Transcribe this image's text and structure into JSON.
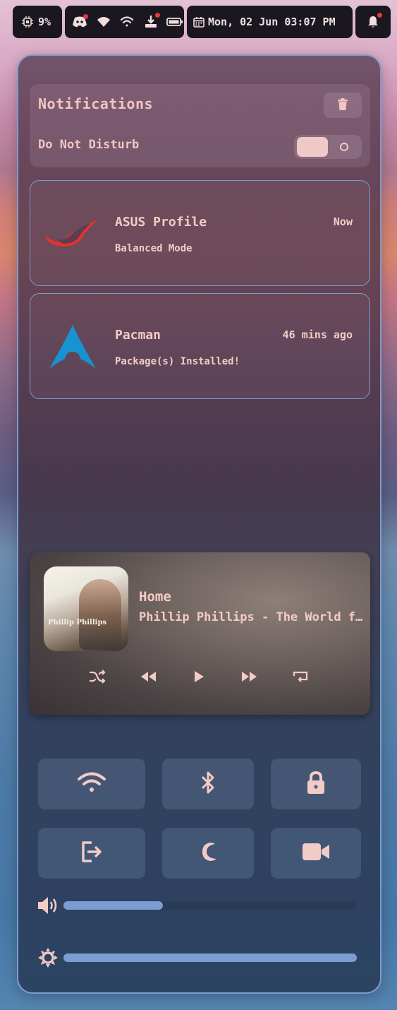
{
  "topbar": {
    "cpu_usage": "9%",
    "clock": "Mon, 02 Jun 03:07 PM"
  },
  "notifications": {
    "title": "Notifications",
    "dnd_label": "Do Not Disturb",
    "dnd_enabled": false,
    "items": [
      {
        "app": "ASUS Profile",
        "time": "Now",
        "body": "Balanced Mode",
        "icon": "rog-logo-icon"
      },
      {
        "app": "Pacman",
        "time": "46 mins ago",
        "body": "Package(s) Installed!",
        "icon": "arch-linux-icon"
      }
    ]
  },
  "media": {
    "title": "Home",
    "artist_line": "Phillip Phillips - The World from the Side of the Moon",
    "album_text": "Phillip Phillips"
  },
  "quick_toggles": [
    "wifi-icon",
    "bluetooth-icon",
    "lock-icon",
    "logout-icon",
    "moon-icon",
    "video-camera-icon"
  ],
  "sliders": {
    "volume_percent": 34,
    "brightness_percent": 100
  },
  "colors": {
    "accent": "#7c9dd2",
    "text": "#f3cbc6",
    "panel_border": "#7f9bd0"
  }
}
